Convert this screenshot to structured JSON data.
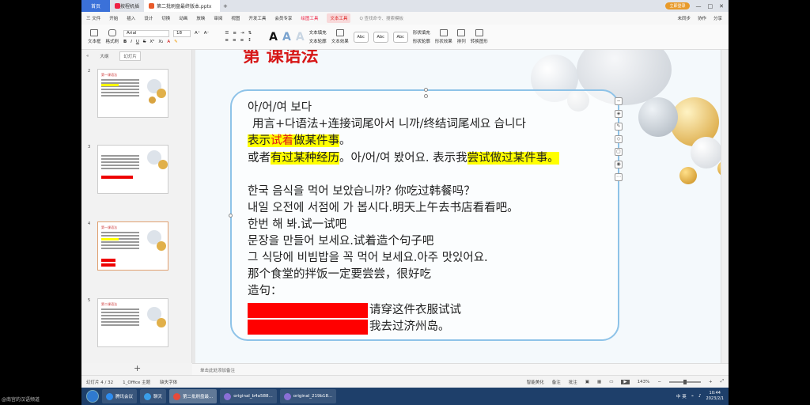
{
  "titlebar": {
    "home_tab": "首页",
    "tabs": [
      "按程机插",
      "第二批刷盘最终版本.pptx"
    ],
    "login": "立即登录"
  },
  "menubar": {
    "items": [
      "三 文件",
      "开始",
      "插入",
      "设计",
      "切换",
      "动画",
      "放映",
      "审阅",
      "视图",
      "开发工具",
      "会员专享"
    ],
    "special": [
      "绘图工具",
      "文本工具"
    ],
    "search": "Q 查找命令、搜索模板",
    "right": [
      "未同步",
      "协作",
      "分享"
    ]
  },
  "ribbon": {
    "textbox_label": "文本框",
    "format_label": "格式刷",
    "font": "Arial",
    "size": "18",
    "style_labels": [
      "Abc",
      "Abc",
      "Abc"
    ],
    "text_fill": "文本填充",
    "text_outline": "文本轮廓",
    "text_effect": "文本效果",
    "shape_fill": "形状填充",
    "shape_outline": "形状轮廓",
    "shape_effect": "形状效果",
    "arrange": "排列",
    "convert": "转换图形"
  },
  "leftpane": {
    "tabs": [
      "大纲",
      "幻灯片"
    ],
    "slides": [
      {
        "num": "2",
        "title": "第一课语法"
      },
      {
        "num": "3",
        "title": ""
      },
      {
        "num": "4",
        "title": "第一课语法"
      },
      {
        "num": "5",
        "title": "第二课语法"
      }
    ]
  },
  "slide": {
    "title": "第  课语法",
    "lines": [
      "아/어/여 보다",
      "用言+다语法+连接词尾아서 니까/终结词尾세요 습니다",
      "或者",
      "한국 음식을 먹어 보았습니까? 你吃过韩餐吗？",
      "내일 오전에 서점에 가 봅시다.明天上午去书店看看吧。",
      "한번 해 봐.试一试吧",
      "문장을 만들어 보세요.试着造个句子吧",
      "그 식당에 비빔밥을 꼭 먹어 보세요.아주  맛있어요.",
      "那个食堂的拌饭一定要尝尝，很好吃",
      "造句："
    ],
    "line3_parts": [
      "表示",
      "试着",
      "做某件事",
      "。"
    ],
    "line4_parts": [
      "有过某种经历",
      "。아/어/여 봤어요. 表示我",
      "尝试做过某件事",
      "。"
    ],
    "exercise": [
      "请穿这件衣服试试",
      "我去过济州岛。"
    ]
  },
  "notes": "单击此处添加备注",
  "statusbar": {
    "slide_info": "幻灯片 4 / 32",
    "theme": "1_Office 主题",
    "font_missing": "缺失字体",
    "smart": "智能美化",
    "notes": "备注",
    "comment": "批注",
    "zoom": "143%"
  },
  "taskbar": {
    "items": [
      "腾讯会议",
      "聊天",
      "第二批刷盘最...",
      "original_b4a588...",
      "original_219b18..."
    ],
    "time": "10:44",
    "date": "2023/2/1",
    "ime": "中 英"
  },
  "watermark": "@南宫的汉语频道"
}
